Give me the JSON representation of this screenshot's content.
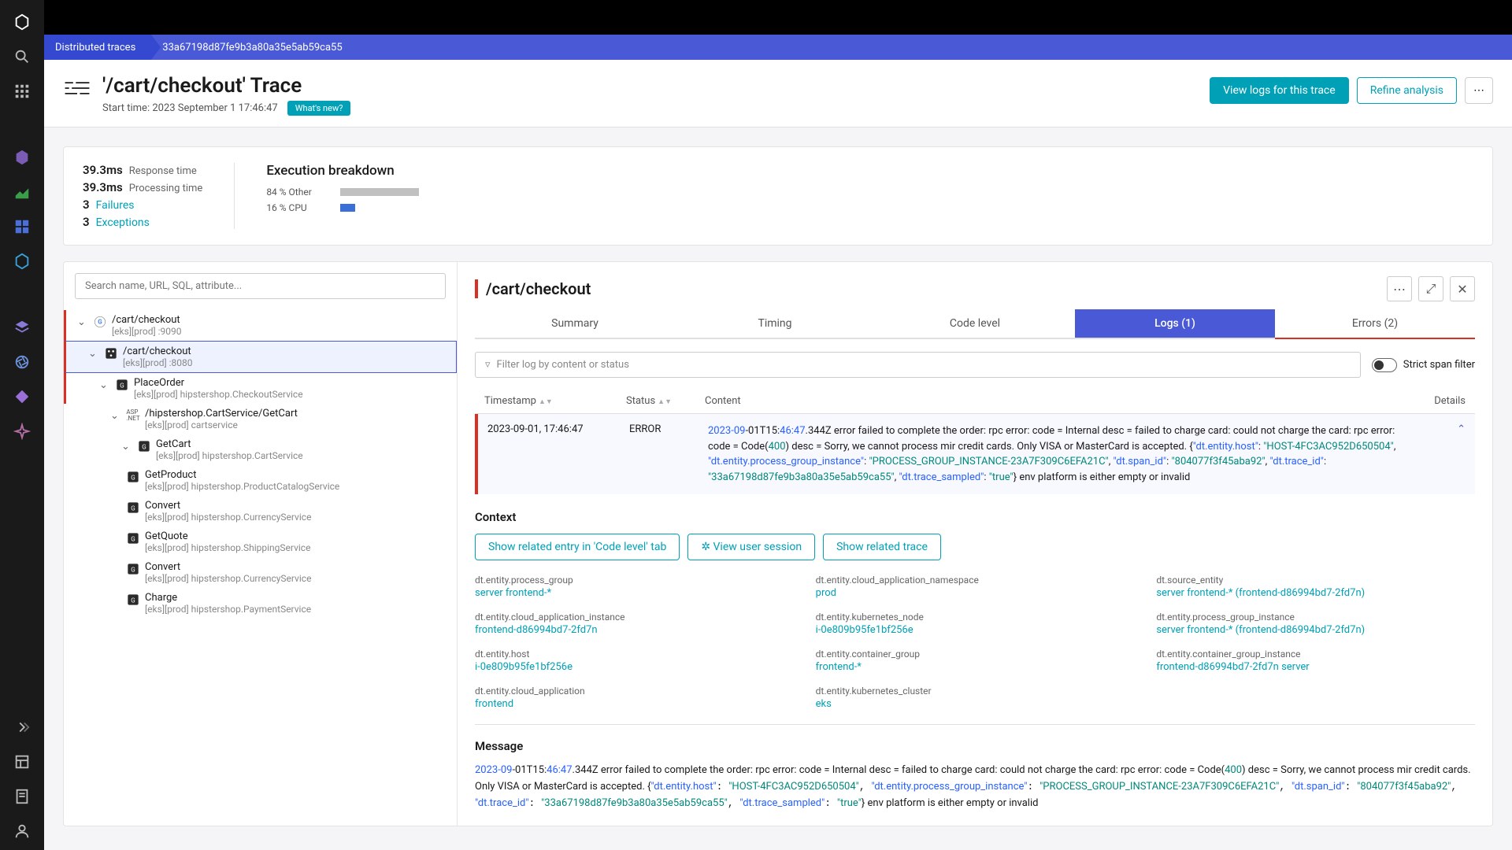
{
  "breadcrumb": {
    "parent": "Distributed traces",
    "current": "33a67198d87fe9b3a80a35e5ab59ca55"
  },
  "header": {
    "title": "'/cart/checkout' Trace",
    "start_time_label": "Start time:",
    "start_time": "2023 September 1 17:46:47",
    "whats_new": "What's new?",
    "view_logs": "View logs for this trace",
    "refine": "Refine analysis"
  },
  "metrics": {
    "response_time_val": "39.3ms",
    "response_time_label": "Response time",
    "processing_time_val": "39.3ms",
    "processing_time_label": "Processing time",
    "failures_count": "3",
    "failures_label": "Failures",
    "exceptions_count": "3",
    "exceptions_label": "Exceptions"
  },
  "breakdown": {
    "title": "Execution breakdown",
    "row1_label": "84 % Other",
    "row2_label": "16 % CPU"
  },
  "search_placeholder": "Search name, URL, SQL, attribute...",
  "tree": [
    {
      "title": "/cart/checkout",
      "sub": "[eks][prod] :9090",
      "indent": 0,
      "error": true,
      "icon": "G"
    },
    {
      "title": "/cart/checkout",
      "sub": "[eks][prod] :8080",
      "indent": 1,
      "error": true,
      "selected": true,
      "icon": "SVC"
    },
    {
      "title": "PlaceOrder",
      "sub": "[eks][prod] hipstershop.CheckoutService",
      "indent": 2,
      "error": true,
      "icon": "G2"
    },
    {
      "title": "/hipstershop.CartService/GetCart",
      "sub": "[eks][prod] cartservice",
      "indent": 3,
      "icon": "ASP"
    },
    {
      "title": "GetCart",
      "sub": "[eks][prod] hipstershop.CartService",
      "indent": 4,
      "icon": "G2"
    },
    {
      "title": "GetProduct",
      "sub": "[eks][prod] hipstershop.ProductCatalogService",
      "indent": 3,
      "icon": "G2",
      "nochev": true
    },
    {
      "title": "Convert",
      "sub": "[eks][prod] hipstershop.CurrencyService",
      "indent": 3,
      "icon": "G2",
      "nochev": true
    },
    {
      "title": "GetQuote",
      "sub": "[eks][prod] hipstershop.ShippingService",
      "indent": 3,
      "icon": "G2",
      "nochev": true
    },
    {
      "title": "Convert",
      "sub": "[eks][prod] hipstershop.CurrencyService",
      "indent": 3,
      "icon": "G2",
      "nochev": true
    },
    {
      "title": "Charge",
      "sub": "[eks][prod] hipstershop.PaymentService",
      "indent": 3,
      "icon": "G2",
      "nochev": true
    }
  ],
  "detail": {
    "title": "/cart/checkout",
    "tabs": {
      "summary": "Summary",
      "timing": "Timing",
      "code": "Code level",
      "logs": "Logs (1)",
      "errors": "Errors (2)"
    },
    "filter_placeholder": "Filter log by content or status",
    "strict_label": "Strict span filter",
    "cols": {
      "ts": "Timestamp",
      "status": "Status",
      "content": "Content",
      "details": "Details"
    },
    "log": {
      "ts": "2023-09-01, 17:46:47",
      "status": "ERROR",
      "content_pre": "2023-09",
      "content_mid1": "-01T15:",
      "content_time": "46:47",
      "content_after_time": ".344Z error failed to complete the order: rpc error: code = Internal desc = failed to charge card: could not charge the card: rpc error: code = Code(",
      "content_400": "400",
      "content_after_400": ") desc = Sorry, we cannot process mir credit cards. Only VISA or MasterCard is accepted. {",
      "kv1_k": "\"dt.entity.host\"",
      "kv1_v": "\"HOST-4FC3AC952D650504\"",
      "kv2_k": "\"dt.entity.process_group_instance\"",
      "kv2_v": "\"PROCESS_GROUP_INSTANCE-23A7F309C6EFA21C\"",
      "kv3_k": "\"dt.span_id\"",
      "kv3_v": "\"804077f3f45aba92\"",
      "kv4_k": "\"dt.trace_id\"",
      "kv4_v": "\"33a67198d87fe9b3a80a35e5ab59ca55\"",
      "kv5_k": "\"dt.trace_sampled\"",
      "kv5_v": "\"true\"",
      "content_tail": "} env platform is either empty or invalid"
    },
    "context": {
      "title": "Context",
      "btn1": "Show related entry in 'Code level' tab",
      "btn2": "View user session",
      "btn3": "Show related trace",
      "items": [
        {
          "label": "dt.entity.process_group",
          "value": "server frontend-*"
        },
        {
          "label": "dt.entity.cloud_application_namespace",
          "value": "prod"
        },
        {
          "label": "dt.source_entity",
          "value": "server frontend-* (frontend-d86994bd7-2fd7n)"
        },
        {
          "label": "dt.entity.cloud_application_instance",
          "value": "frontend-d86994bd7-2fd7n"
        },
        {
          "label": "dt.entity.kubernetes_node",
          "value": "i-0e809b95fe1bf256e"
        },
        {
          "label": "dt.entity.process_group_instance",
          "value": "server frontend-* (frontend-d86994bd7-2fd7n)"
        },
        {
          "label": "dt.entity.host",
          "value": "i-0e809b95fe1bf256e"
        },
        {
          "label": "dt.entity.container_group",
          "value": "frontend-*"
        },
        {
          "label": "dt.entity.container_group_instance",
          "value": "frontend-d86994bd7-2fd7n server"
        },
        {
          "label": "dt.entity.cloud_application",
          "value": "frontend"
        },
        {
          "label": "dt.entity.kubernetes_cluster",
          "value": "eks"
        }
      ]
    },
    "message": {
      "title": "Message",
      "pre": "2023-09",
      "mid1": "-01T15:",
      "time": "46:47",
      "after_time": ".344Z error failed to complete the order: rpc error: code = Internal desc = failed to charge card: could not charge the card: rpc error: code = Code(",
      "n400": "400",
      "after_400": ") desc = Sorry, we cannot process mir credit cards. Only VISA or MasterCard is accepted. {",
      "k1": "\"dt.entity.host\"",
      "v1": "\"HOST-4FC3AC952D650504\"",
      "k2": "\"dt.entity.process_group_instance\"",
      "v2": "\"PROCESS_GROUP_INSTANCE-23A7F309C6EFA21C\"",
      "k3": "\"dt.span_id\"",
      "v3": "\"804077f3f45aba92\"",
      "k4": "\"dt.trace_id\"",
      "v4": "\"33a67198d87fe9b3a80a35e5ab59ca55\"",
      "k5": "\"dt.trace_sampled\"",
      "v5": "\"true\"",
      "tail": "} env platform is either empty or invalid"
    }
  }
}
